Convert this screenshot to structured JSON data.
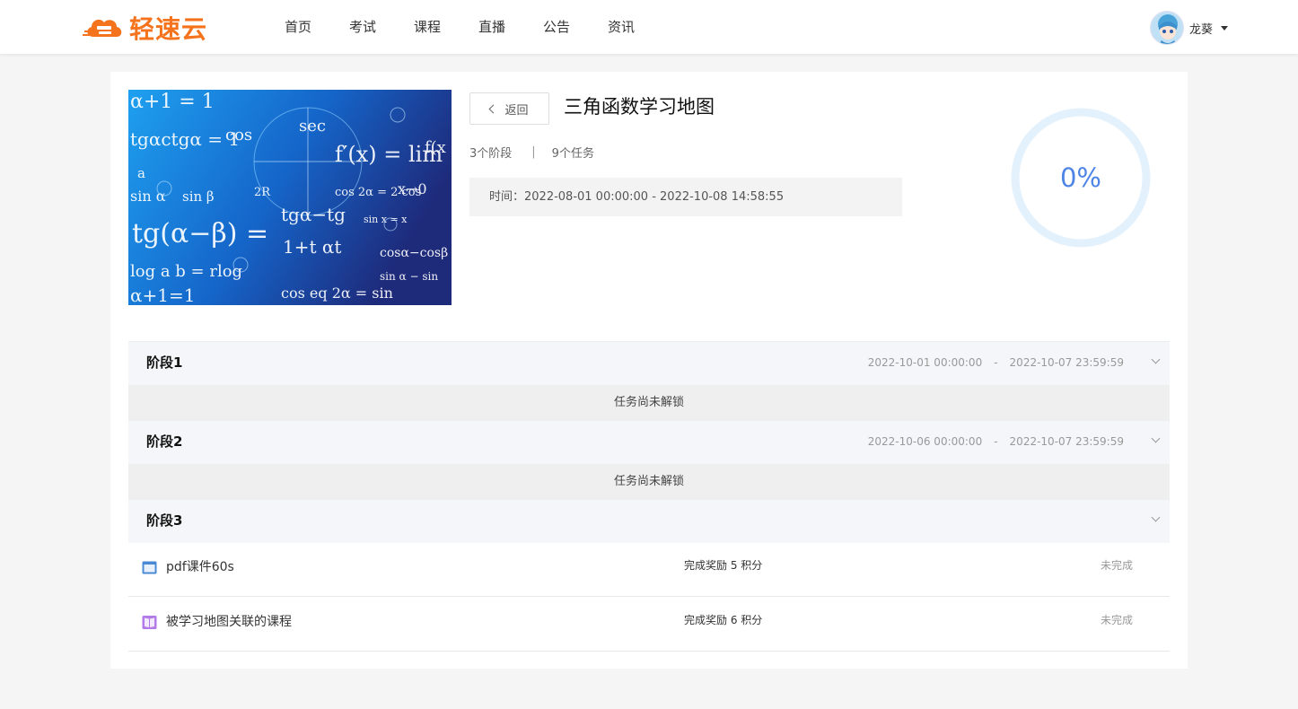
{
  "header": {
    "logo_text": "轻速云",
    "nav": [
      "首页",
      "考试",
      "课程",
      "直播",
      "公告",
      "资讯"
    ],
    "username": "龙葵"
  },
  "course": {
    "back_label": "返回",
    "title": "三角函数学习地图",
    "stages_count": "3个阶段",
    "tasks_count": "9个任务",
    "time_range": "时间：2022-08-01 00:00:00 - 2022-10-08 14:58:55",
    "progress": 0,
    "progress_label": "0%"
  },
  "stages": [
    {
      "name": "阶段1",
      "start": "2022-10-01 00:00:00",
      "end": "2022-10-07 23:59:59",
      "locked_text": "任务尚未解锁"
    },
    {
      "name": "阶段2",
      "start": "2022-10-06 00:00:00",
      "end": "2022-10-07 23:59:59",
      "locked_text": "任务尚未解锁"
    },
    {
      "name": "阶段3",
      "tasks": [
        {
          "icon": "folder-icon",
          "name": "pdf课件60s",
          "reward": "完成奖励 5 积分",
          "status": "未完成"
        },
        {
          "icon": "book-icon",
          "name": "被学习地图关联的课程",
          "reward": "完成奖励 6 积分",
          "status": "未完成"
        }
      ]
    }
  ],
  "colors": {
    "brand": "#f5731c",
    "progress_text": "#4d84e6",
    "progress_ring": "#e3f1fd",
    "folder_icon": "#4a8ad4",
    "book_icon": "#b37be8"
  }
}
